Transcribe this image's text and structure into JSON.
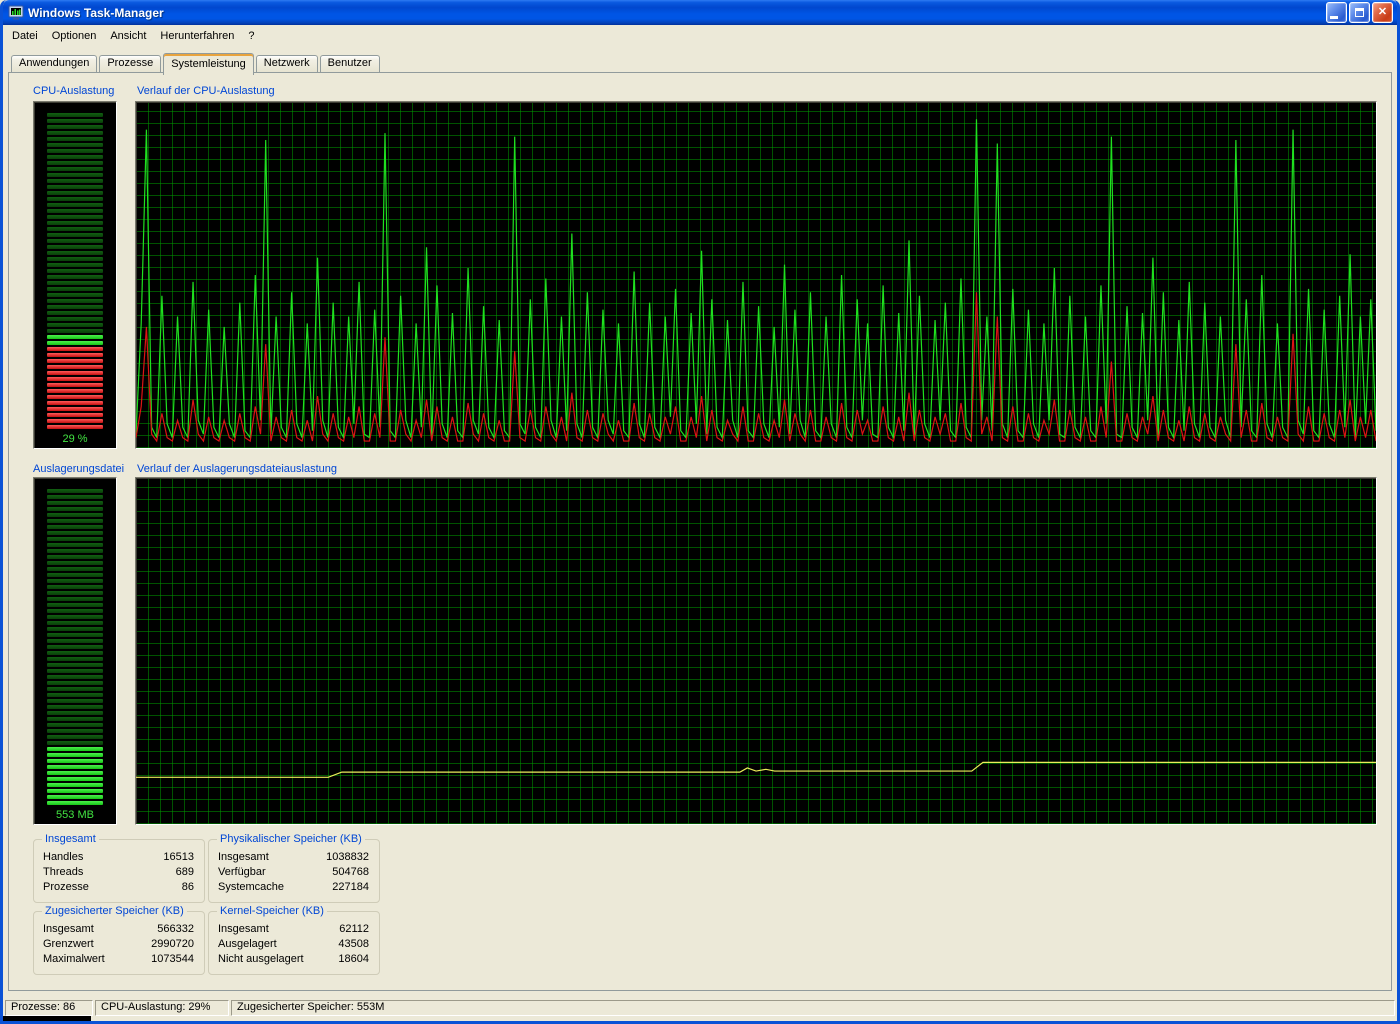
{
  "window": {
    "title": "Windows Task-Manager"
  },
  "menu": {
    "items": [
      "Datei",
      "Optionen",
      "Ansicht",
      "Herunterfahren",
      "?"
    ]
  },
  "tabs": {
    "items": [
      "Anwendungen",
      "Prozesse",
      "Systemleistung",
      "Netzwerk",
      "Benutzer"
    ],
    "active": "Systemleistung"
  },
  "sections": {
    "cpu_gauge_label": "CPU-Auslastung",
    "cpu_history_label": "Verlauf der CPU-Auslastung",
    "pf_gauge_label": "Auslagerungsdatei",
    "pf_history_label": "Verlauf der Auslagerungsdateiauslastung"
  },
  "gauges": {
    "cpu": {
      "value_label": "29 %",
      "percent": 29,
      "segments_total": 53,
      "lit_segments": 16,
      "red_segments": 14
    },
    "pagefile": {
      "value_label": "553 MB",
      "segments_total": 53,
      "lit_segments": 10,
      "red_segments": 0
    }
  },
  "groups": [
    {
      "title": "Insgesamt",
      "rows": [
        [
          "Handles",
          "16513"
        ],
        [
          "Threads",
          "689"
        ],
        [
          "Prozesse",
          "86"
        ]
      ]
    },
    {
      "title": "Physikalischer Speicher (KB)",
      "rows": [
        [
          "Insgesamt",
          "1038832"
        ],
        [
          "Verfügbar",
          "504768"
        ],
        [
          "Systemcache",
          "227184"
        ]
      ]
    },
    {
      "title": "Zugesicherter Speicher (KB)",
      "rows": [
        [
          "Insgesamt",
          "566332"
        ],
        [
          "Grenzwert",
          "2990720"
        ],
        [
          "Maximalwert",
          "1073544"
        ]
      ]
    },
    {
      "title": "Kernel-Speicher (KB)",
      "rows": [
        [
          "Insgesamt",
          "62112"
        ],
        [
          "Ausgelagert",
          "43508"
        ],
        [
          "Nicht ausgelagert",
          "18604"
        ]
      ]
    }
  ],
  "statusbar": {
    "processes": "Prozesse: 86",
    "cpu": "CPU-Auslastung: 29%",
    "commit": "Zugesicherter Speicher: 553M"
  },
  "colors": {
    "titlebar_blue": "#0055E5",
    "label_blue": "#0046D5",
    "panel_tan": "#ECE9D8",
    "cpu_line_green": "#1FE01F",
    "kernel_line_red": "#DC1414",
    "pagefile_line_yellow": "#ECEC5A",
    "grid_green": "#009600"
  },
  "chart_data": [
    {
      "type": "line",
      "title": "Verlauf der CPU-Auslastung",
      "ylim": [
        0,
        100
      ],
      "grid": true,
      "legend": "none",
      "series": [
        {
          "name": "CPU-Auslastung (%)",
          "color": "#1FE01F",
          "values": [
            4,
            36,
            92,
            6,
            3,
            44,
            7,
            3,
            38,
            6,
            3,
            48,
            8,
            4,
            40,
            6,
            3,
            35,
            7,
            3,
            42,
            5,
            3,
            50,
            8,
            89,
            4,
            38,
            6,
            3,
            45,
            7,
            3,
            36,
            5,
            55,
            8,
            3,
            42,
            6,
            3,
            38,
            7,
            48,
            4,
            3,
            40,
            6,
            91,
            5,
            3,
            44,
            8,
            3,
            36,
            6,
            58,
            3,
            47,
            7,
            3,
            39,
            5,
            3,
            52,
            8,
            4,
            41,
            6,
            3,
            37,
            5,
            3,
            90,
            7,
            4,
            43,
            6,
            3,
            49,
            8,
            3,
            38,
            5,
            62,
            7,
            3,
            45,
            6,
            3,
            40,
            8,
            4,
            36,
            5,
            3,
            51,
            7,
            3,
            42,
            6,
            3,
            38,
            9,
            46,
            5,
            3,
            39,
            7,
            57,
            4,
            43,
            6,
            3,
            37,
            8,
            3,
            48,
            5,
            3,
            41,
            7,
            3,
            35,
            6,
            53,
            4,
            40,
            8,
            3,
            45,
            5,
            3,
            38,
            7,
            3,
            50,
            6,
            3,
            43,
            8,
            36,
            4,
            3,
            47,
            6,
            3,
            39,
            5,
            60,
            3,
            44,
            7,
            3,
            37,
            8,
            42,
            5,
            3,
            49,
            6,
            3,
            95,
            8,
            38,
            5,
            88,
            7,
            3,
            46,
            5,
            3,
            40,
            7,
            3,
            36,
            8,
            52,
            4,
            3,
            44,
            6,
            3,
            38,
            5,
            3,
            47,
            7,
            90,
            4,
            3,
            41,
            6,
            3,
            39,
            8,
            55,
            3,
            45,
            6,
            3,
            37,
            5,
            48,
            7,
            3,
            42,
            6,
            3,
            38,
            8,
            3,
            89,
            6,
            43,
            5,
            3,
            50,
            7,
            3,
            36,
            6,
            3,
            92,
            8,
            4,
            46,
            5,
            3,
            40,
            7,
            3,
            44,
            6,
            56,
            3,
            38,
            7,
            43,
            5
          ]
        },
        {
          "name": "Kernel-Zeiten (%)",
          "color": "#DC1414",
          "values": [
            3,
            12,
            35,
            4,
            2,
            10,
            3,
            2,
            8,
            3,
            2,
            14,
            4,
            2,
            9,
            3,
            2,
            8,
            3,
            2,
            10,
            3,
            2,
            12,
            4,
            30,
            2,
            9,
            3,
            2,
            11,
            3,
            2,
            8,
            2,
            15,
            4,
            2,
            10,
            3,
            2,
            9,
            3,
            12,
            2,
            2,
            10,
            3,
            32,
            2,
            2,
            11,
            4,
            2,
            8,
            3,
            14,
            2,
            12,
            3,
            2,
            9,
            2,
            2,
            13,
            4,
            2,
            10,
            3,
            2,
            8,
            2,
            2,
            28,
            3,
            2,
            11,
            3,
            2,
            12,
            4,
            2,
            9,
            2,
            16,
            3,
            2,
            11,
            3,
            2,
            10,
            4,
            2,
            8,
            2,
            2,
            13,
            3,
            2,
            10,
            3,
            2,
            9,
            4,
            12,
            2,
            2,
            9,
            3,
            15,
            2,
            11,
            3,
            2,
            8,
            4,
            2,
            12,
            2,
            2,
            10,
            3,
            2,
            8,
            3,
            14,
            2,
            10,
            4,
            2,
            11,
            2,
            2,
            9,
            3,
            2,
            13,
            3,
            2,
            11,
            4,
            8,
            2,
            2,
            12,
            3,
            2,
            9,
            2,
            16,
            2,
            11,
            3,
            2,
            9,
            4,
            10,
            2,
            2,
            13,
            3,
            2,
            45,
            4,
            9,
            2,
            38,
            3,
            2,
            12,
            2,
            2,
            10,
            3,
            2,
            8,
            4,
            14,
            2,
            2,
            11,
            3,
            2,
            9,
            2,
            2,
            12,
            3,
            25,
            2,
            2,
            10,
            3,
            2,
            9,
            4,
            15,
            2,
            11,
            3,
            2,
            8,
            2,
            12,
            3,
            2,
            10,
            3,
            2,
            9,
            4,
            2,
            30,
            3,
            11,
            2,
            2,
            13,
            3,
            2,
            9,
            3,
            2,
            33,
            4,
            2,
            12,
            2,
            2,
            10,
            3,
            2,
            11,
            3,
            14,
            2,
            9,
            3,
            11,
            2
          ]
        }
      ]
    },
    {
      "type": "line",
      "title": "Verlauf der Auslagerungsdateiauslastung",
      "ylim": [
        0,
        100
      ],
      "grid": true,
      "legend": "none",
      "series": [
        {
          "name": "Auslagerungsdatei-Auslastung (%)",
          "color": "#ECEC5A",
          "points": [
            [
              0,
              13.5
            ],
            [
              0.155,
              13.5
            ],
            [
              0.166,
              15.0
            ],
            [
              0.487,
              15.0
            ],
            [
              0.493,
              16.2
            ],
            [
              0.5,
              15.3
            ],
            [
              0.508,
              15.8
            ],
            [
              0.515,
              15.3
            ],
            [
              0.674,
              15.3
            ],
            [
              0.683,
              17.8
            ],
            [
              1,
              17.8
            ]
          ]
        }
      ]
    }
  ]
}
